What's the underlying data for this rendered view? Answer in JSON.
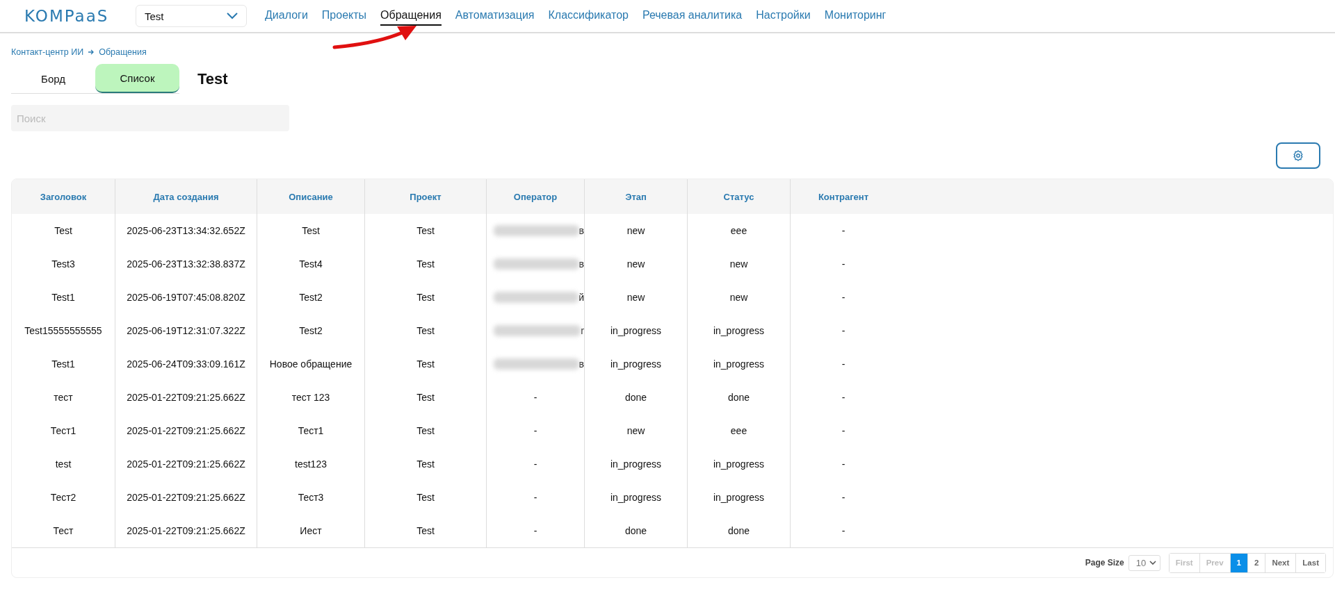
{
  "header": {
    "logo": "KOMPaaS",
    "project_select": "Test",
    "nav": [
      {
        "label": "Диалоги",
        "selected": false
      },
      {
        "label": "Проекты",
        "selected": false
      },
      {
        "label": "Обращения",
        "selected": true
      },
      {
        "label": "Автоматизация",
        "selected": false
      },
      {
        "label": "Классификатор",
        "selected": false
      },
      {
        "label": "Речевая аналитика",
        "selected": false
      },
      {
        "label": "Настройки",
        "selected": false
      },
      {
        "label": "Мониторинг",
        "selected": false
      }
    ]
  },
  "breadcrumbs": [
    "Контакт-центр ИИ",
    "Обращения"
  ],
  "view_tabs": [
    {
      "label": "Борд",
      "selected": false
    },
    {
      "label": "Список",
      "selected": true
    }
  ],
  "page_title": "Test",
  "search": {
    "placeholder": "Поиск"
  },
  "table": {
    "columns": [
      "Заголовок",
      "Дата создания",
      "Описание",
      "Проект",
      "Оператор",
      "Этап",
      "Статус",
      "Контрагент"
    ],
    "rows": [
      {
        "title": "Test",
        "created": "2025-06-23T13:34:32.652Z",
        "description": "Test",
        "project": "Test",
        "operator": {
          "redacted": true,
          "text": "в"
        },
        "stage": "new",
        "status": "eee",
        "counterparty": "-"
      },
      {
        "title": "Test3",
        "created": "2025-06-23T13:32:38.837Z",
        "description": "Test4",
        "project": "Test",
        "operator": {
          "redacted": true,
          "text": "в"
        },
        "stage": "new",
        "status": "new",
        "counterparty": "-"
      },
      {
        "title": "Test1",
        "created": "2025-06-19T07:45:08.820Z",
        "description": "Test2",
        "project": "Test",
        "operator": {
          "redacted": true,
          "text": "й"
        },
        "stage": "new",
        "status": "new",
        "counterparty": "-"
      },
      {
        "title": "Test15555555555",
        "created": "2025-06-19T12:31:07.322Z",
        "description": "Test2",
        "project": "Test",
        "operator": {
          "redacted": true,
          "text": "r"
        },
        "stage": "in_progress",
        "status": "in_progress",
        "counterparty": "-"
      },
      {
        "title": "Test1",
        "created": "2025-06-24T09:33:09.161Z",
        "description": "Новое обращение",
        "project": "Test",
        "operator": {
          "redacted": true,
          "text": "в"
        },
        "stage": "in_progress",
        "status": "in_progress",
        "counterparty": "-"
      },
      {
        "title": "тест",
        "created": "2025-01-22T09:21:25.662Z",
        "description": "тест 123",
        "project": "Test",
        "operator": {
          "redacted": false,
          "text": "-"
        },
        "stage": "done",
        "status": "done",
        "counterparty": "-"
      },
      {
        "title": "Тест1",
        "created": "2025-01-22T09:21:25.662Z",
        "description": "Тест1",
        "project": "Test",
        "operator": {
          "redacted": false,
          "text": "-"
        },
        "stage": "new",
        "status": "eee",
        "counterparty": "-"
      },
      {
        "title": "test",
        "created": "2025-01-22T09:21:25.662Z",
        "description": "test123",
        "project": "Test",
        "operator": {
          "redacted": false,
          "text": "-"
        },
        "stage": "in_progress",
        "status": "in_progress",
        "counterparty": "-"
      },
      {
        "title": "Тест2",
        "created": "2025-01-22T09:21:25.662Z",
        "description": "Тест3",
        "project": "Test",
        "operator": {
          "redacted": false,
          "text": "-"
        },
        "stage": "in_progress",
        "status": "in_progress",
        "counterparty": "-"
      },
      {
        "title": "Тест",
        "created": "2025-01-22T09:21:25.662Z",
        "description": "Иест",
        "project": "Test",
        "operator": {
          "redacted": false,
          "text": "-"
        },
        "stage": "done",
        "status": "done",
        "counterparty": "-"
      }
    ]
  },
  "pagination": {
    "page_size_label": "Page Size",
    "page_size": "10",
    "buttons": [
      {
        "label": "First",
        "disabled": true,
        "selected": false
      },
      {
        "label": "Prev",
        "disabled": true,
        "selected": false
      },
      {
        "label": "1",
        "disabled": false,
        "selected": true
      },
      {
        "label": "2",
        "disabled": false,
        "selected": false
      },
      {
        "label": "Next",
        "disabled": false,
        "selected": false
      },
      {
        "label": "Last",
        "disabled": false,
        "selected": false
      }
    ]
  }
}
